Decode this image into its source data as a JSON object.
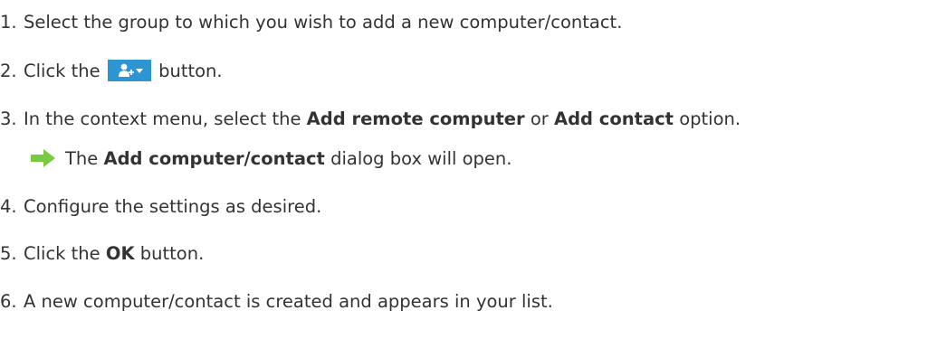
{
  "steps": [
    {
      "number": "1.",
      "text": "Select the group to which you wish to add a new computer/contact."
    },
    {
      "number": "2.",
      "before": "Click the",
      "after": "button.",
      "button_icon": "add-person-dropdown-icon"
    },
    {
      "number": "3.",
      "before": "In the context menu, select the",
      "bold1": "Add remote computer",
      "middle": "or",
      "bold2": "Add contact",
      "after": "option."
    },
    {
      "number": "4.",
      "text": "Configure the settings as desired."
    },
    {
      "number": "5.",
      "before": "Click the",
      "bold": "OK",
      "after": "button."
    },
    {
      "number": "6.",
      "text": "A new computer/contact is created and appears in your list."
    }
  ],
  "result": {
    "icon": "green-arrow-right-icon",
    "before": "The",
    "bold": "Add computer/contact",
    "after": "dialog box will open."
  },
  "colors": {
    "button_background": "#2e95d3",
    "arrow_green": "#7ac943",
    "text": "#333333"
  }
}
